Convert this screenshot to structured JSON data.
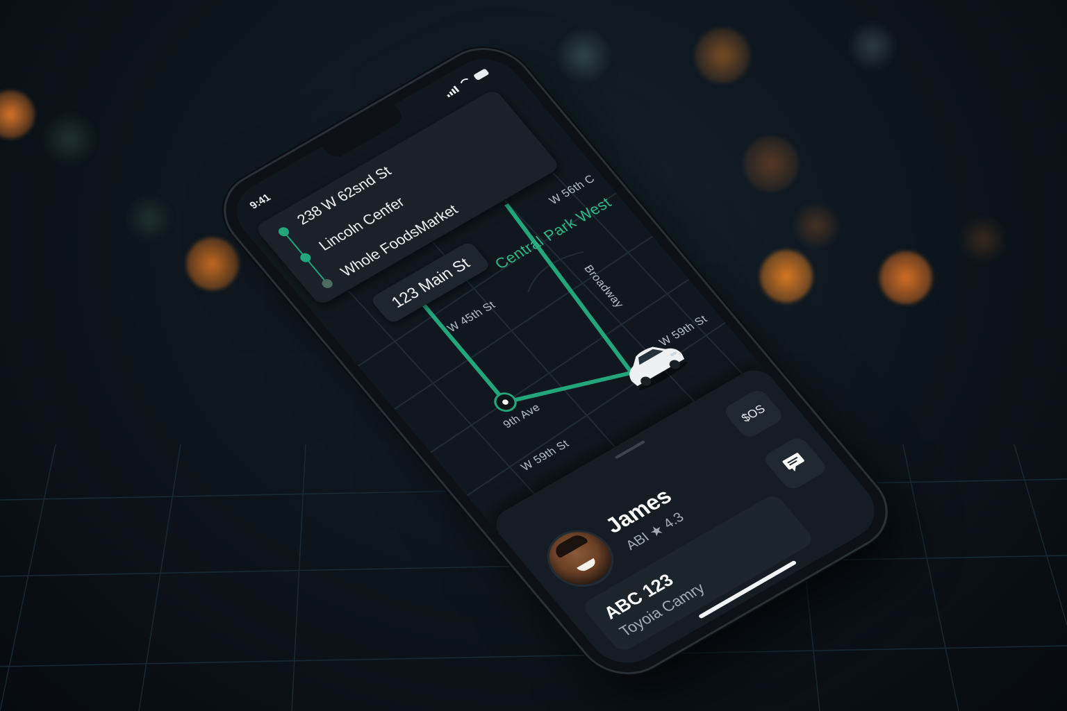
{
  "status_bar": {
    "time": "9:41"
  },
  "route": {
    "stops": [
      "238 W 62snd St",
      "Lincoln Cenfer",
      "Whole FoodsMarket"
    ],
    "origin": "123 Main St"
  },
  "map": {
    "streets": {
      "w56": "W 56th C",
      "central_park_west": "Central Park West",
      "w45": "W 45th St",
      "vertical": "Broadway",
      "w59_right": "W 59th St",
      "ninth_ave": "9th Ave",
      "w59_bottom": "W 59th St"
    },
    "route_color": "#22a67a"
  },
  "driver": {
    "name": "James",
    "code": "ABI",
    "rating": "4.3",
    "price": "$OS",
    "plate": "ABC 123",
    "car_model": "Toyoia Camry"
  },
  "icons": [
    "star-icon",
    "chat-icon",
    "signal-icon",
    "wifi-icon",
    "battery-icon",
    "car-icon",
    "location-pin-icon"
  ]
}
